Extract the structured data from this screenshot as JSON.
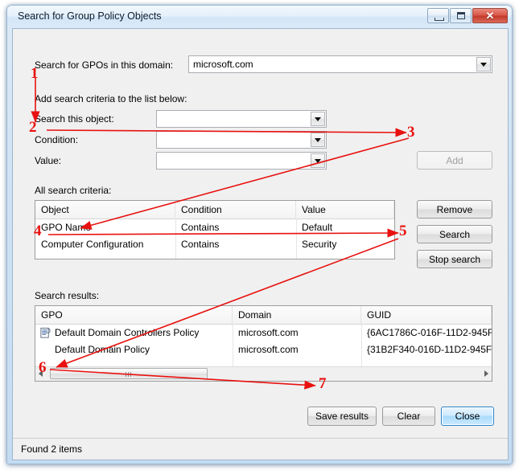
{
  "window": {
    "title": "Search for Group Policy Objects",
    "buttons": {
      "minimize": "minimize",
      "maximize": "maximize",
      "close": "✕"
    }
  },
  "domain_row": {
    "label": "Search for GPOs in this domain:",
    "value": "microsoft.com"
  },
  "criteria_section": {
    "label": "Add search criteria to the list below:",
    "fields": [
      {
        "label": "Search this object:",
        "value": ""
      },
      {
        "label": "Condition:",
        "value": ""
      },
      {
        "label": "Value:",
        "value": ""
      }
    ],
    "add_button": "Add"
  },
  "all_criteria": {
    "label": "All search criteria:",
    "columns": [
      "Object",
      "Condition",
      "Value"
    ],
    "rows": [
      [
        "GPO Name",
        "Contains",
        "Default"
      ],
      [
        "Computer Configuration",
        "Contains",
        "Security"
      ]
    ],
    "buttons": {
      "remove": "Remove",
      "search": "Search",
      "stop_search": "Stop search"
    }
  },
  "search_results": {
    "label": "Search results:",
    "columns": [
      "GPO",
      "Domain",
      "GUID"
    ],
    "rows": [
      [
        "Default Domain Controllers Policy",
        "microsoft.com",
        "{6AC1786C-016F-11D2-945F"
      ],
      [
        "Default Domain Policy",
        "microsoft.com",
        "{31B2F340-016D-11D2-945F"
      ]
    ]
  },
  "footer_buttons": {
    "save_results": "Save results",
    "clear": "Clear",
    "close": "Close"
  },
  "statusbar": {
    "text": "Found 2 items"
  },
  "annotations": {
    "color": "#e8110f",
    "items": [
      {
        "number": "1"
      },
      {
        "number": "2"
      },
      {
        "number": "3"
      },
      {
        "number": "4"
      },
      {
        "number": "5"
      },
      {
        "number": "6"
      },
      {
        "number": "7"
      }
    ]
  }
}
